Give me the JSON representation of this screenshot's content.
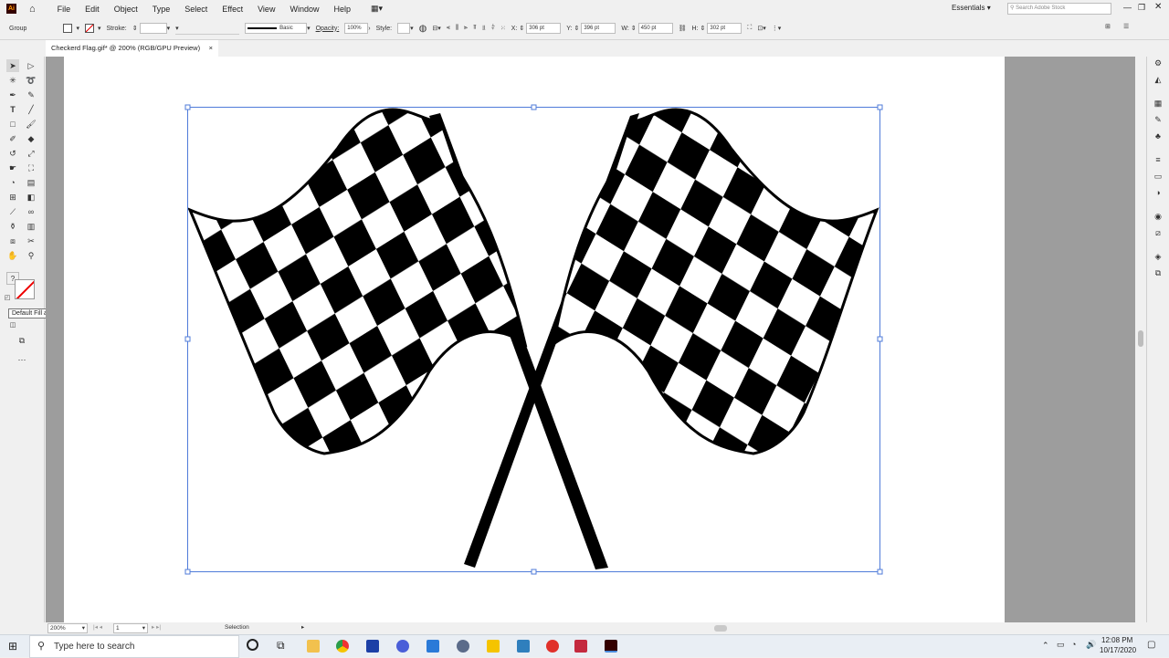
{
  "app": {
    "logo": "Ai"
  },
  "menu": [
    "File",
    "Edit",
    "Object",
    "Type",
    "Select",
    "Effect",
    "View",
    "Window",
    "Help"
  ],
  "workspace": {
    "label": "Essentials",
    "search_placeholder": "Search Adobe Stock"
  },
  "control_bar": {
    "selection": "Group",
    "stroke_label": "Stroke:",
    "brush_label": "Basic",
    "opacity_label": "Opacity:",
    "opacity_value": "100%",
    "style_label": "Style:",
    "x_label": "X:",
    "x_value": "306 pt",
    "y_label": "Y:",
    "y_value": "396 pt",
    "w_label": "W:",
    "w_value": "450 pt",
    "h_label": "H:",
    "h_value": "302 pt"
  },
  "document": {
    "tab_title": "Checkerd Flag.gif* @ 200% (RGB/GPU Preview)",
    "close": "×"
  },
  "tooltip": "Default Fill and Stroke (D)",
  "status": {
    "zoom": "200%",
    "artboard": "1",
    "tool": "Selection"
  },
  "taskbar": {
    "search_placeholder": "Type here to search",
    "time": "12:08 PM",
    "date": "10/17/2020",
    "apps": [
      "task-view",
      "file-explorer",
      "chrome",
      "ru-app",
      "pen-app",
      "blue-app",
      "gear-app",
      "yellow-app",
      "calc-app",
      "media-app",
      "red-app",
      "illustrator"
    ]
  }
}
